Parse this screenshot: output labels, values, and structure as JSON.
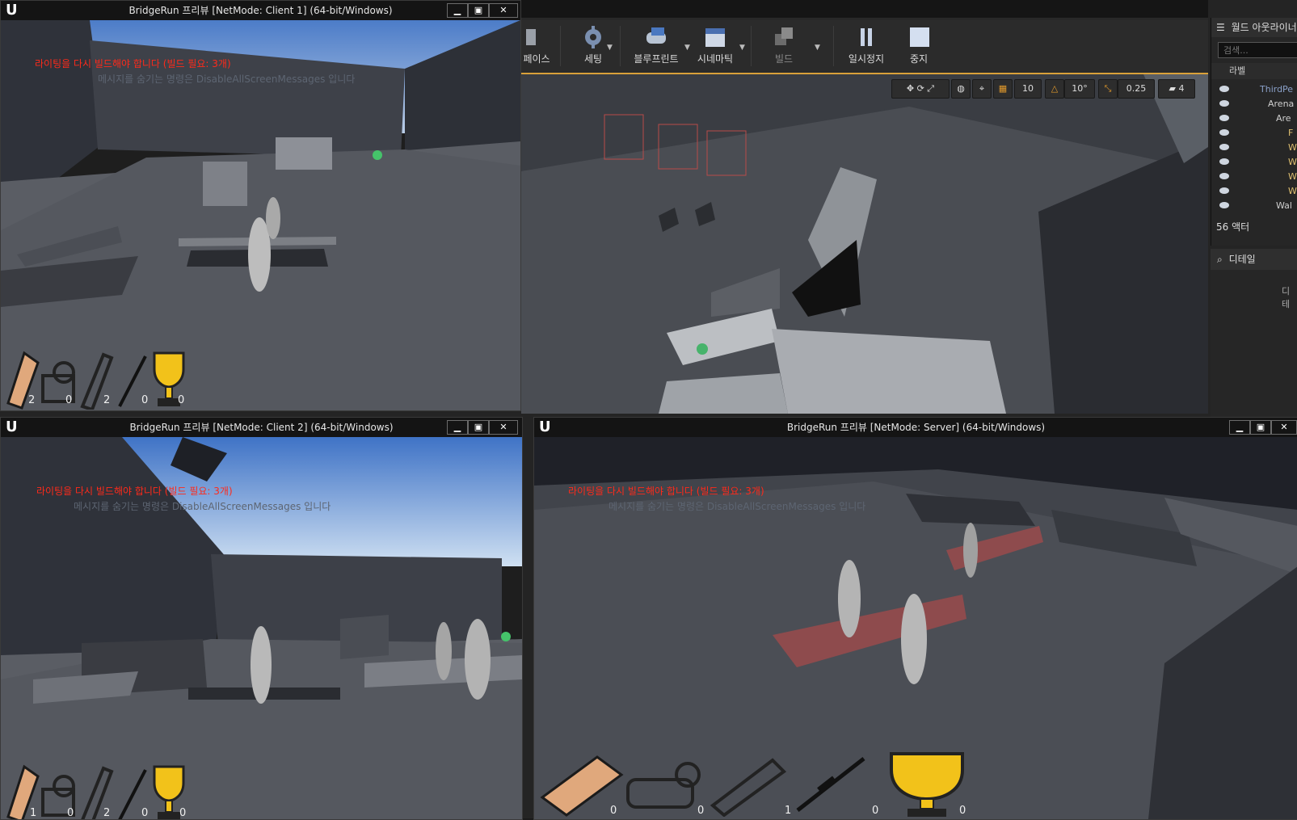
{
  "editor": {
    "toolbar": [
      {
        "label": "페이스",
        "icon": "content-icon"
      },
      {
        "label": "세팅",
        "icon": "settings-gear-icon"
      },
      {
        "label": "블루프린트",
        "icon": "blueprint-controller-icon"
      },
      {
        "label": "시네마틱",
        "icon": "clapper-icon"
      },
      {
        "label": "빌드",
        "icon": "build-cubes-icon"
      },
      {
        "label": "일시정지",
        "icon": "pause-icon"
      },
      {
        "label": "중지",
        "icon": "stop-icon"
      }
    ],
    "viewport_tools": {
      "grid_snap": "10",
      "rot_snap": "10°",
      "scale_snap": "0.25",
      "cam_speed": "4"
    },
    "outliner": {
      "title": "월드 아웃라이너",
      "search_placeholder": "검색...",
      "column_label": "라벨",
      "items": [
        "ThirdPe",
        "Arena",
        "Are",
        "F",
        "W",
        "W",
        "W",
        "W",
        "Wal"
      ],
      "actor_count": "56 액터"
    },
    "details": {
      "title": "디테일",
      "hint": "디테"
    }
  },
  "pie_windows": {
    "client1": {
      "title": "BridgeRun 프리뷰 [NetMode: Client 1]  (64-bit/Windows)",
      "warning": "라이팅을 다시 빌드해야 합니다 (빌드 필요: 3개)",
      "hint": "메시지를 숨기는 명령은 DisableAllScreenMessages 입니다",
      "hud": [
        "2",
        "0",
        "2",
        "0",
        "0"
      ]
    },
    "client2": {
      "title": "BridgeRun 프리뷰 [NetMode: Client 2]  (64-bit/Windows)",
      "warning": "라이팅을 다시 빌드해야 합니다 (빌드 필요: 3개)",
      "hint": "메시지를 숨기는 명령은 DisableAllScreenMessages 입니다",
      "hud": [
        "1",
        "0",
        "2",
        "0",
        "0"
      ]
    },
    "server": {
      "title": "BridgeRun 프리뷰 [NetMode: Server]  (64-bit/Windows)",
      "warning": "라이팅을 다시 빌드해야 합니다 (빌드 필요: 3개)",
      "hint": "메시지를 숨기는 명령은 DisableAllScreenMessages 입니다",
      "hud": [
        "0",
        "0",
        "1",
        "0",
        "0"
      ]
    }
  },
  "hud_icons": [
    "wood-plank-icon",
    "rope-roll-icon",
    "telescope-icon",
    "sniper-rifle-icon",
    "trophy-icon"
  ],
  "colors": {
    "warning": "#ff2a1a",
    "toolbar_accent": "#d9a13a",
    "trophy": "#f2c21a",
    "wood": "#e0a87c"
  }
}
